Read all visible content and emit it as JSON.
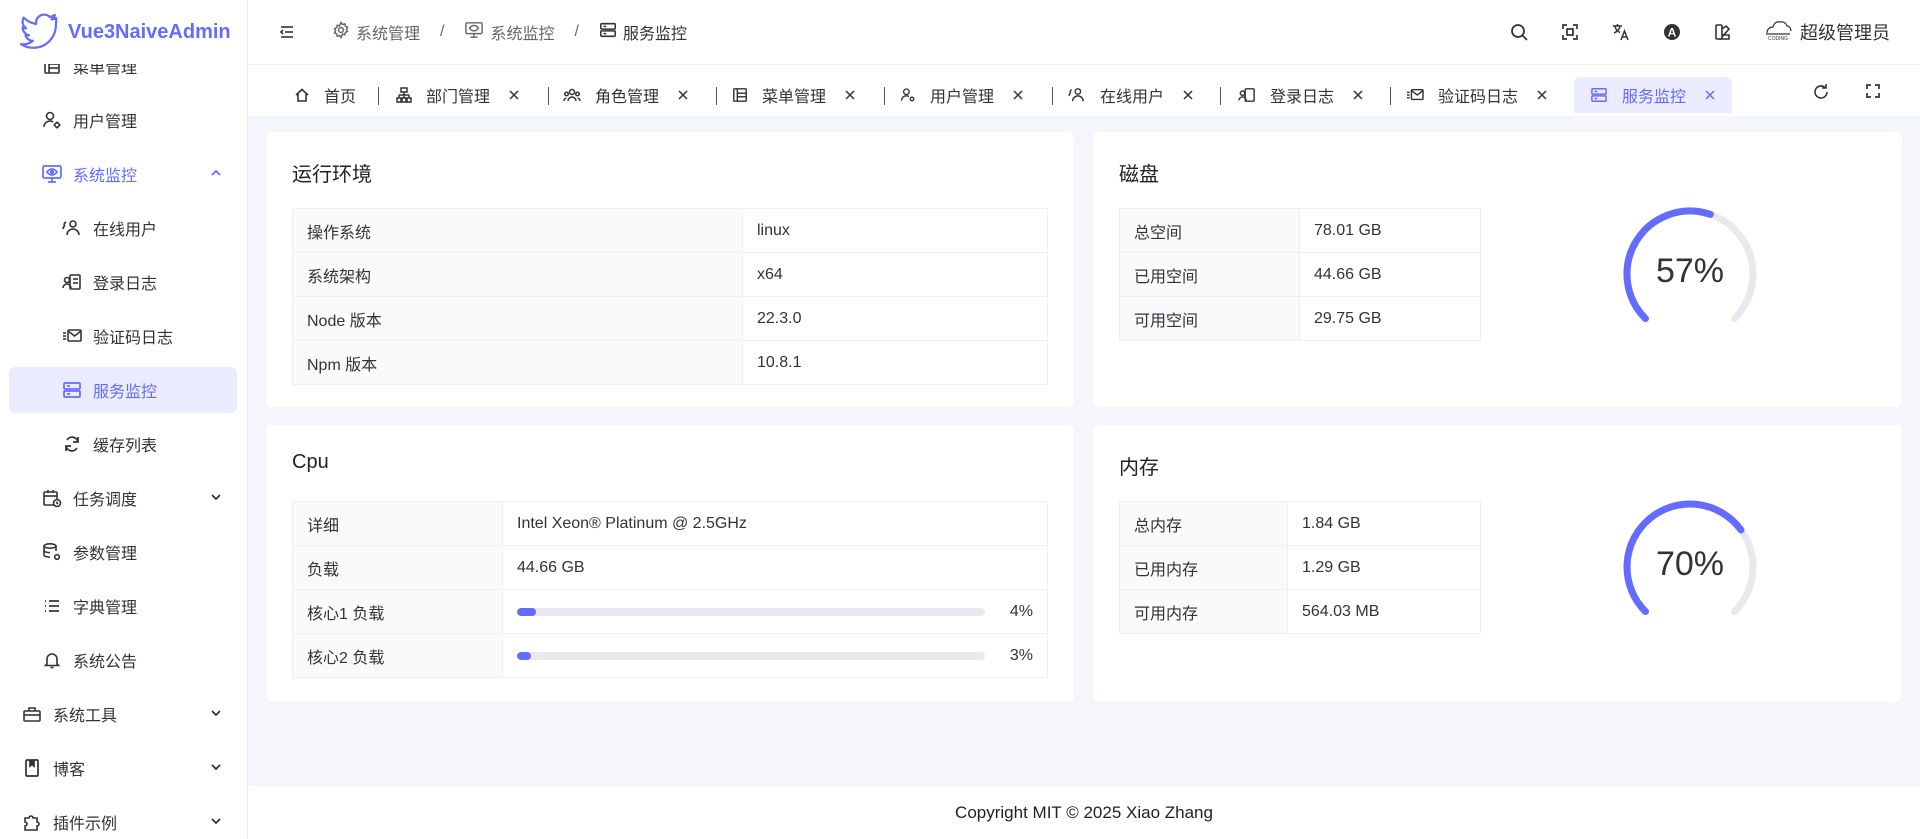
{
  "app": {
    "name": "Vue3NaiveAdmin"
  },
  "sidebar": {
    "items": [
      {
        "label": "菜单管理",
        "icon": "menu-table-icon"
      },
      {
        "label": "用户管理",
        "icon": "user-gear-icon"
      },
      {
        "label": "系统监控",
        "icon": "monitor-eye-icon",
        "expanded": true
      },
      {
        "label": "在线用户",
        "icon": "users-online-icon"
      },
      {
        "label": "登录日志",
        "icon": "login-log-icon"
      },
      {
        "label": "验证码日志",
        "icon": "mail-log-icon"
      },
      {
        "label": "服务监控",
        "icon": "server-icon",
        "active": true
      },
      {
        "label": "缓存列表",
        "icon": "refresh-icon"
      },
      {
        "label": "任务调度",
        "icon": "calendar-clock-icon"
      },
      {
        "label": "参数管理",
        "icon": "database-gear-icon"
      },
      {
        "label": "字典管理",
        "icon": "list-icon"
      },
      {
        "label": "系统公告",
        "icon": "bell-icon"
      },
      {
        "label": "系统工具",
        "icon": "toolbox-icon"
      },
      {
        "label": "博客",
        "icon": "blog-icon"
      },
      {
        "label": "插件示例",
        "icon": "puzzle-icon"
      }
    ]
  },
  "header": {
    "breadcrumb": [
      "系统管理",
      "系统监控",
      "服务监控"
    ],
    "user_name": "超级管理员"
  },
  "tabs": [
    {
      "label": "首页"
    },
    {
      "label": "部门管理"
    },
    {
      "label": "角色管理"
    },
    {
      "label": "菜单管理"
    },
    {
      "label": "用户管理"
    },
    {
      "label": "在线用户"
    },
    {
      "label": "登录日志"
    },
    {
      "label": "验证码日志"
    },
    {
      "label": "服务监控",
      "active": true
    }
  ],
  "env": {
    "title": "运行环境",
    "rows": [
      {
        "k": "操作系统",
        "v": "linux"
      },
      {
        "k": "系统架构",
        "v": "x64"
      },
      {
        "k": "Node 版本",
        "v": "22.3.0"
      },
      {
        "k": "Npm 版本",
        "v": "10.8.1"
      }
    ]
  },
  "disk": {
    "title": "磁盘",
    "rows": [
      {
        "k": "总空间",
        "v": "78.01 GB"
      },
      {
        "k": "已用空间",
        "v": "44.66 GB"
      },
      {
        "k": "可用空间",
        "v": "29.75 GB"
      }
    ],
    "percent": 57,
    "percent_label": "57%"
  },
  "cpu": {
    "title": "Cpu",
    "detail_key": "详细",
    "detail_val": "Intel Xeon® Platinum @ 2.5GHz",
    "load_key": "负载",
    "load_val": "44.66 GB",
    "cores": [
      {
        "k": "核心1 负载",
        "percent": 4,
        "label": "4%"
      },
      {
        "k": "核心2 负载",
        "percent": 3,
        "label": "3%"
      }
    ]
  },
  "memory": {
    "title": "内存",
    "rows": [
      {
        "k": "总内存",
        "v": "1.84 GB"
      },
      {
        "k": "已用内存",
        "v": "1.29 GB"
      },
      {
        "k": "可用内存",
        "v": "564.03 MB"
      }
    ],
    "percent": 70,
    "percent_label": "70%"
  },
  "footer": {
    "text": "Copyright MIT © 2025 Xiao Zhang"
  },
  "colors": {
    "accent": "#646cff",
    "track": "#e8e8ee",
    "active_bg": "#ebecff"
  }
}
